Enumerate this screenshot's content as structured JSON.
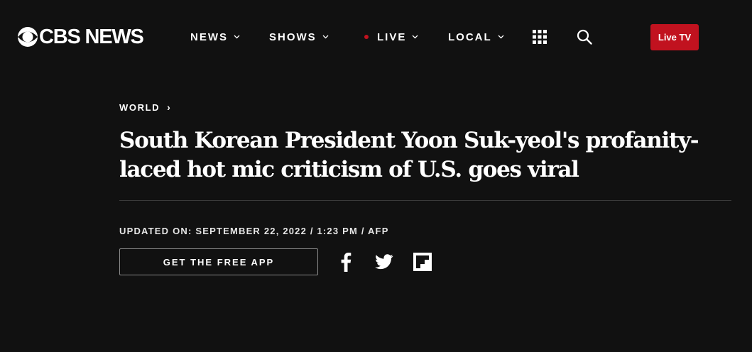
{
  "brand": {
    "logo_text": "CBS NEWS",
    "accent_color": "#c1121f",
    "background": "#111111"
  },
  "nav": {
    "items": [
      {
        "label": "NEWS",
        "has_dropdown": true
      },
      {
        "label": "SHOWS",
        "has_dropdown": true
      },
      {
        "label": "LIVE",
        "has_dropdown": true,
        "live_indicator": true
      },
      {
        "label": "LOCAL",
        "has_dropdown": true
      }
    ],
    "grid_icon": "grid-icon",
    "search_icon": "search-icon",
    "live_tv_label": "Live TV"
  },
  "article": {
    "breadcrumb": "WORLD",
    "breadcrumb_arrow": "›",
    "headline": "South Korean President Yoon Suk-yeol's profanity-laced hot mic criticism of U.S. goes viral",
    "byline": "UPDATED ON: SEPTEMBER 22, 2022 / 1:23 PM / AFP"
  },
  "actions": {
    "app_button_label": "GET THE FREE APP",
    "share_icons": [
      "facebook-icon",
      "twitter-icon",
      "flipboard-icon"
    ]
  }
}
